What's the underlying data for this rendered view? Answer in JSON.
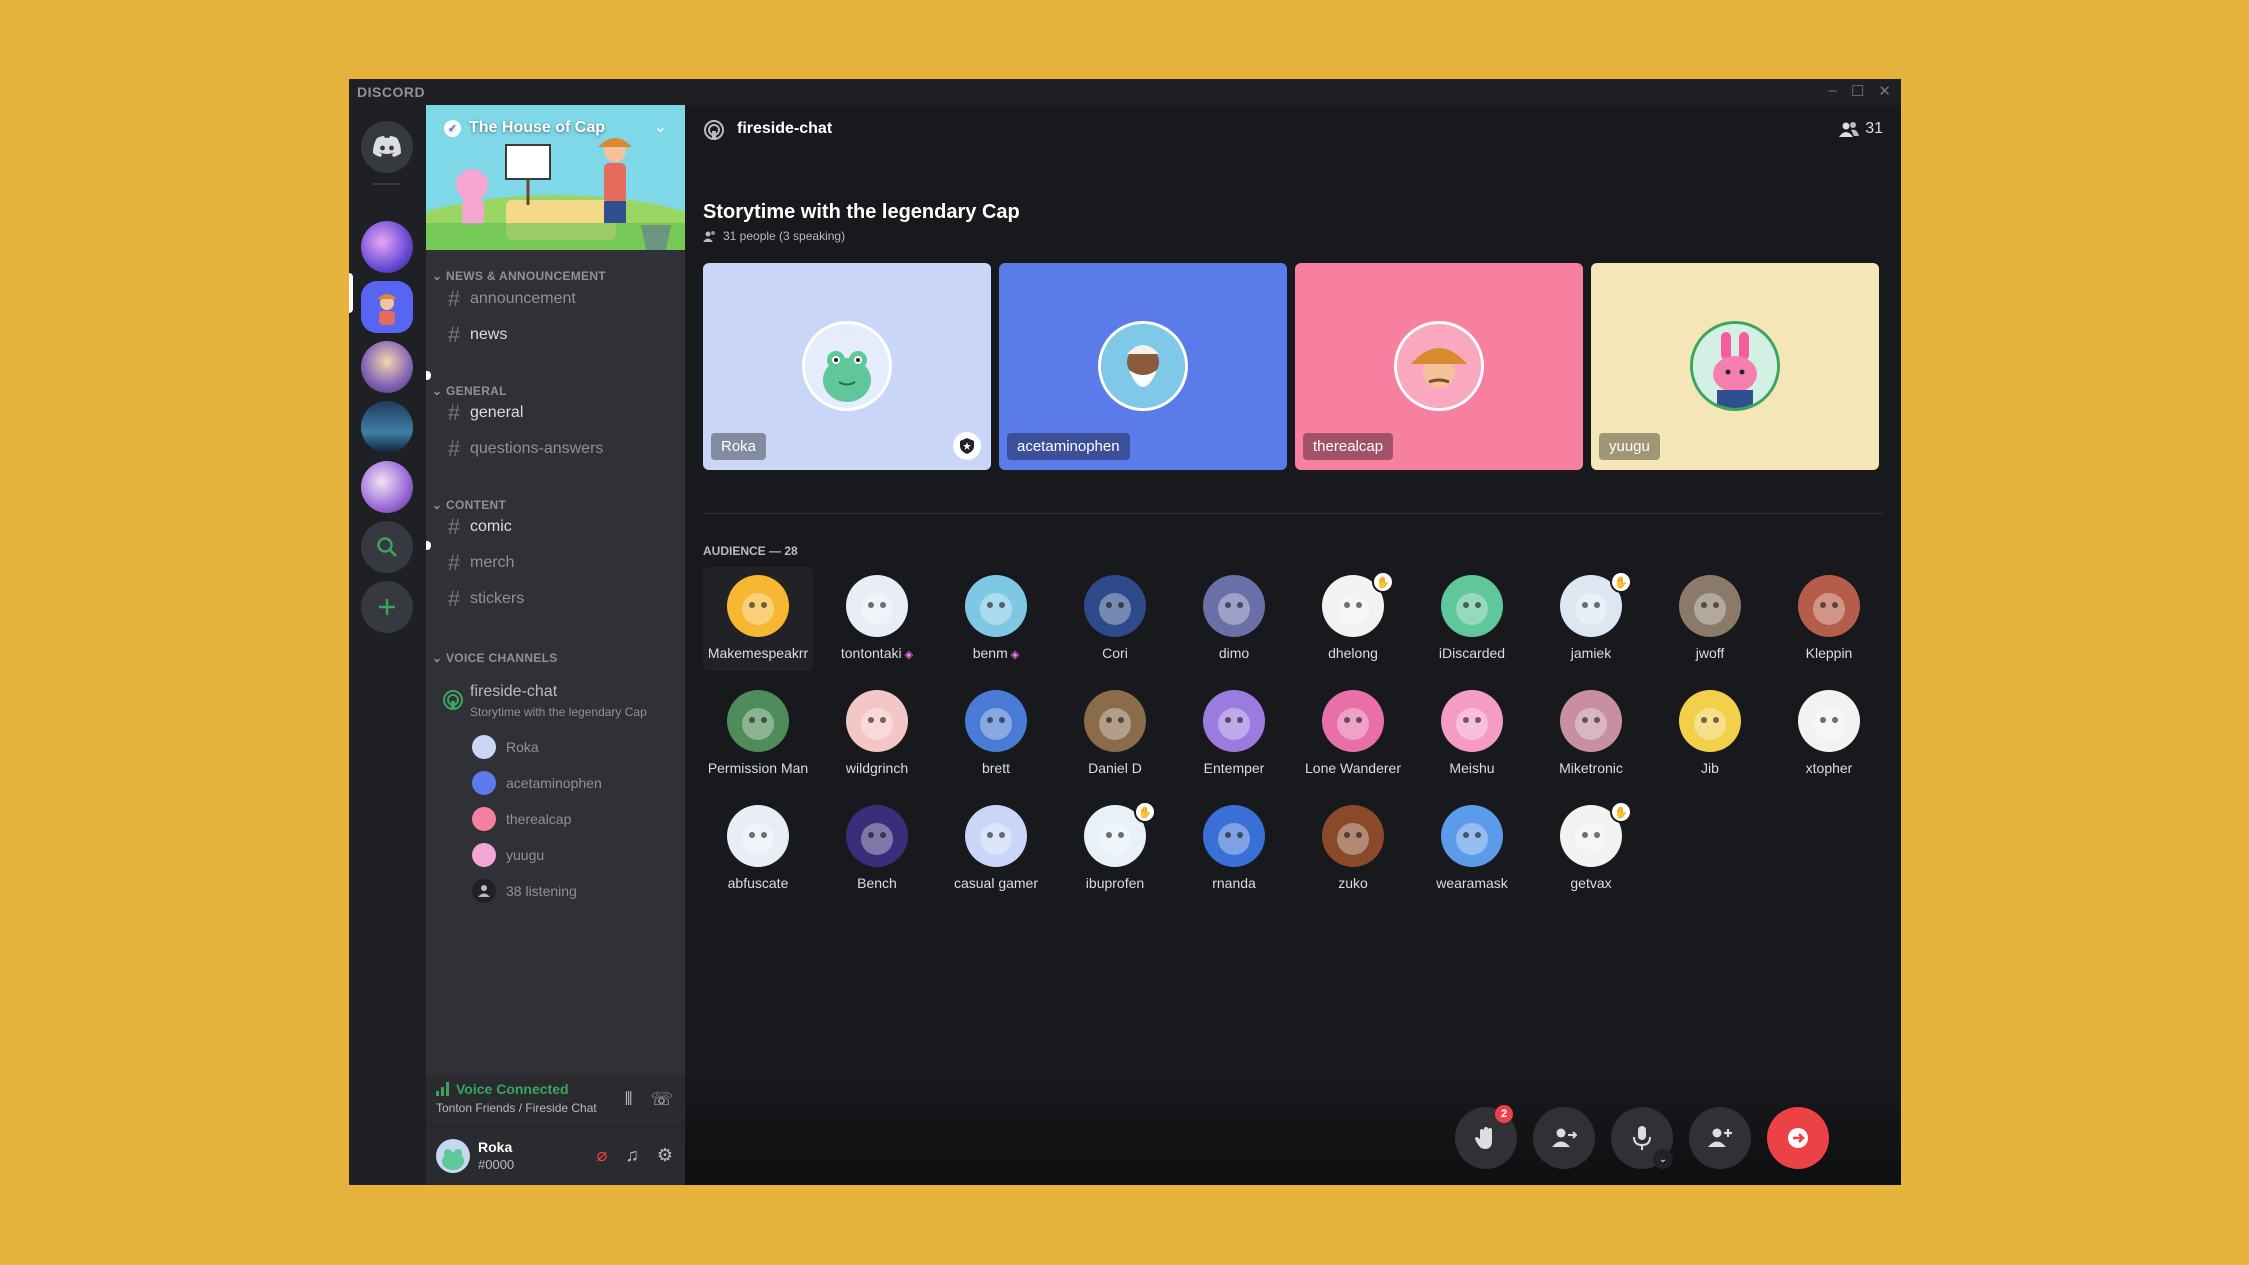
{
  "window": {
    "brand": "DISCORD",
    "controls": [
      "–",
      "☐",
      "✕"
    ]
  },
  "server": {
    "name": "The House of Cap",
    "categories": {
      "news": "NEWS & ANNOUNCEMENT",
      "general": "GENERAL",
      "content": "CONTENT",
      "voice": "VOICE CHANNELS"
    },
    "channels": {
      "announcement": "announcement",
      "news": "news",
      "general": "general",
      "questions": "questions-answers",
      "comic": "comic",
      "merch": "merch",
      "stickers": "stickers"
    },
    "voice_channel": {
      "name": "fireside-chat",
      "topic": "Storytime with the legendary Cap",
      "users": [
        "Roka",
        "acetaminophen",
        "therealcap",
        "yuugu"
      ],
      "listening": "38 listening"
    }
  },
  "voice_status": {
    "label": "Voice Connected",
    "location": "Tonton Friends / Fireside Chat"
  },
  "me": {
    "name": "Roka",
    "tag": "#0000"
  },
  "stage": {
    "channel": "fireside-chat",
    "member_count": "31",
    "title": "Storytime with the legendary Cap",
    "subtitle": "31 people (3 speaking)",
    "speakers": [
      {
        "name": "Roka",
        "color": "#C9D6F8"
      },
      {
        "name": "acetaminophen",
        "color": "#5B7BEA"
      },
      {
        "name": "therealcap",
        "color": "#F77FA0"
      },
      {
        "name": "yuugu",
        "color": "#F4E6B6"
      }
    ],
    "audience_label": "AUDIENCE — 28",
    "audience": [
      "Makemespeakrr",
      "tontontaki",
      "benm",
      "Cori",
      "dimo",
      "dhelong",
      "iDiscarded",
      "jamiek",
      "jwoff",
      "Kleppin",
      "Permission Man",
      "wildgrinch",
      "brett",
      "Daniel D",
      "Entemper",
      "Lone Wanderer",
      "Meishu",
      "Miketronic",
      "Jib",
      "xtopher",
      "abfuscate",
      "Bench",
      "casual gamer",
      "ibuprofen",
      "rnanda",
      "zuko",
      "wearamask",
      "getvax"
    ],
    "hand_raise_count": "2"
  },
  "colors": {
    "accent": "#5865F2",
    "connected": "#3BA55D",
    "leave": "#ED4245",
    "background": "#E6B43C"
  }
}
